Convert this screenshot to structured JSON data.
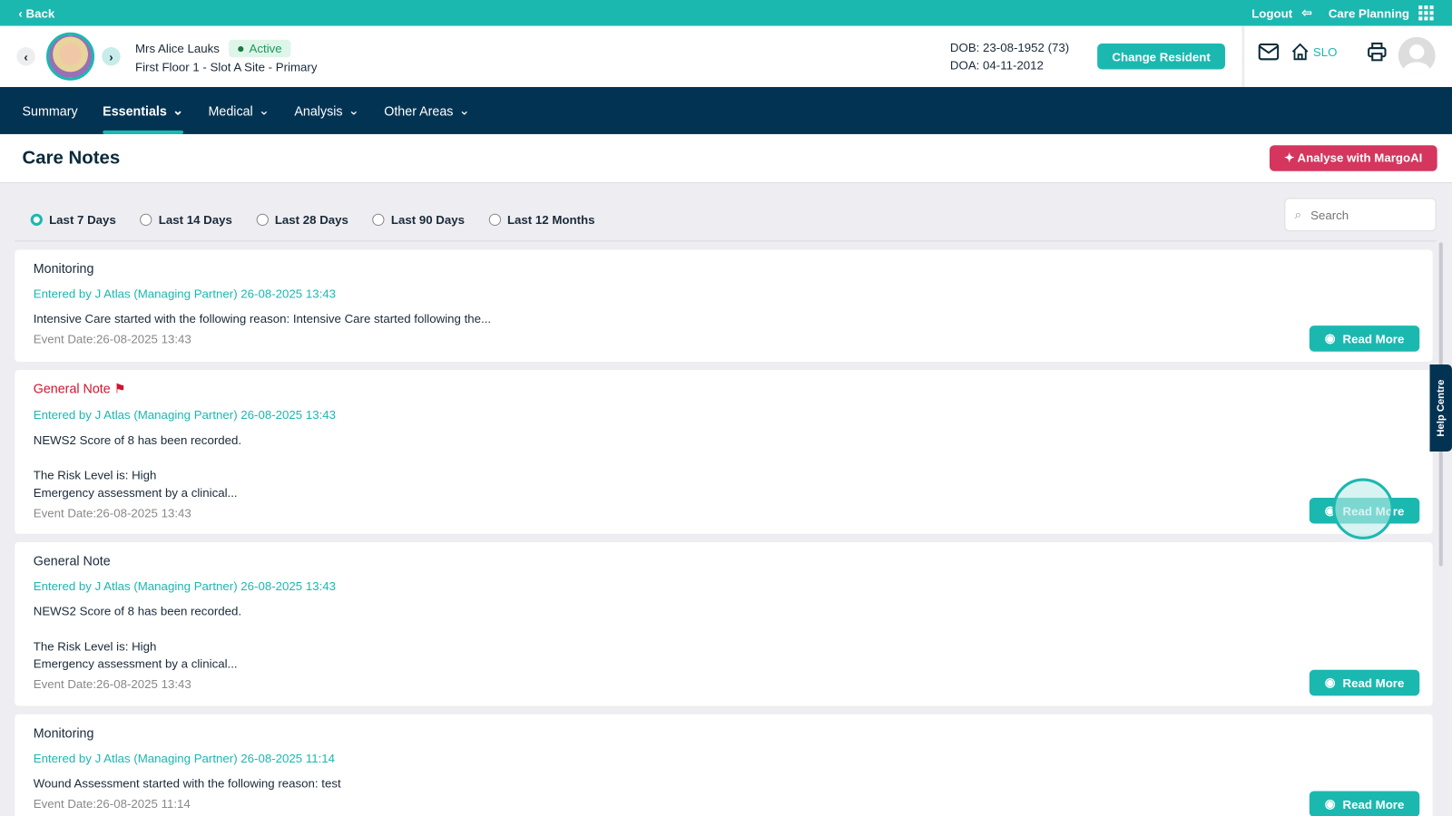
{
  "topbar": {
    "back": "‹ Back",
    "logout": "Logout",
    "care_planning": "Care Planning"
  },
  "resident": {
    "name": "Mrs Alice Lauks",
    "status": "Active",
    "location": "First Floor 1 - Slot A Site - Primary",
    "dob": "DOB: 23-08-1952 (73)",
    "doa": "DOA: 04-11-2012",
    "change": "Change Resident",
    "home": "SLO"
  },
  "nav": [
    {
      "label": "Summary"
    },
    {
      "label": "Essentials"
    },
    {
      "label": "Medical"
    },
    {
      "label": "Analysis"
    },
    {
      "label": "Other Areas"
    }
  ],
  "page": {
    "title": "Care Notes",
    "ai_button": "Analyse with MargoAI",
    "search_placeholder": "Search"
  },
  "filters": [
    {
      "label": "Last 7 Days",
      "selected": true
    },
    {
      "label": "Last 14 Days"
    },
    {
      "label": "Last 28 Days"
    },
    {
      "label": "Last 90 Days"
    },
    {
      "label": "Last 12 Months"
    }
  ],
  "notes": [
    {
      "title": "Monitoring",
      "by": "Entered by J Atlas (Managing Partner) 26-08-2025 13:43",
      "body": "Intensive Care started with the following reason: Intensive Care started following the...",
      "event": "Event Date:26-08-2025 13:43",
      "read": "Read More"
    },
    {
      "title": "General Note",
      "by": "Entered by J Atlas (Managing Partner) 26-08-2025 13:43",
      "body": "NEWS2 Score of 8 has been recorded.\n\nThe Risk Level is: High\nEmergency assessment by a clinical...",
      "event": "Event Date:26-08-2025 13:43",
      "read": "Read More"
    },
    {
      "title": "General Note",
      "by": "Entered by J Atlas (Managing Partner) 26-08-2025 13:43",
      "body": "NEWS2 Score of 8 has been recorded.\n\nThe Risk Level is: High\nEmergency assessment by a clinical...",
      "event": "Event Date:26-08-2025 13:43",
      "read": "Read More"
    },
    {
      "title": "Monitoring",
      "by": "Entered by J Atlas (Managing Partner) 26-08-2025 11:14",
      "body": "Wound Assessment started with the following reason: test",
      "event": "Event Date:26-08-2025 11:14",
      "read": "Read More"
    }
  ],
  "help": "Help Centre",
  "colors": {
    "teal": "#1bb8b0",
    "navy": "#033352",
    "ai": "#d4365e",
    "flag": "#d0142c"
  }
}
